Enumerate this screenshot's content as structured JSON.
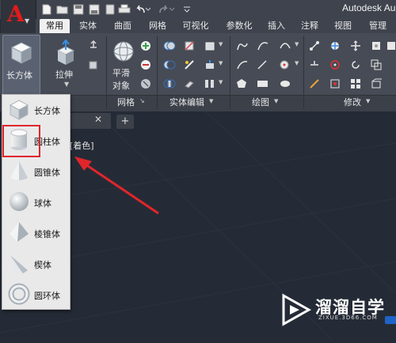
{
  "app": {
    "title": "Autodesk Au",
    "logo_letter": "A"
  },
  "tabs": [
    {
      "label": "常用",
      "active": true
    },
    {
      "label": "实体"
    },
    {
      "label": "曲面"
    },
    {
      "label": "网格"
    },
    {
      "label": "可视化"
    },
    {
      "label": "参数化"
    },
    {
      "label": "插入"
    },
    {
      "label": "注释"
    },
    {
      "label": "视图"
    },
    {
      "label": "管理"
    }
  ],
  "ribbon": {
    "box_label": "长方体",
    "extrude_label": "拉伸",
    "smooth_label_1": "平滑",
    "smooth_label_2": "对象",
    "panels": {
      "mesh": "网格",
      "solid_edit": "实体编辑",
      "draw": "绘图",
      "modify": "修改"
    }
  },
  "viewport": {
    "visual_style_label": "[着色]"
  },
  "dropdown": {
    "items": [
      {
        "label": "长方体",
        "icon": "box-icon"
      },
      {
        "label": "圆柱体",
        "icon": "cylinder-icon",
        "highlighted": true
      },
      {
        "label": "圆锥体",
        "icon": "cone-icon"
      },
      {
        "label": "球体",
        "icon": "sphere-icon"
      },
      {
        "label": "棱锥体",
        "icon": "pyramid-icon"
      },
      {
        "label": "楔体",
        "icon": "wedge-icon"
      },
      {
        "label": "圆环体",
        "icon": "torus-icon"
      }
    ]
  },
  "watermark": {
    "text": "溜溜自学",
    "sub": "ZIXUE.3D66.COM"
  },
  "colors": {
    "accent_red": "#e0262b",
    "ribbon_bg": "#464b55",
    "canvas_bg": "#252b36"
  }
}
